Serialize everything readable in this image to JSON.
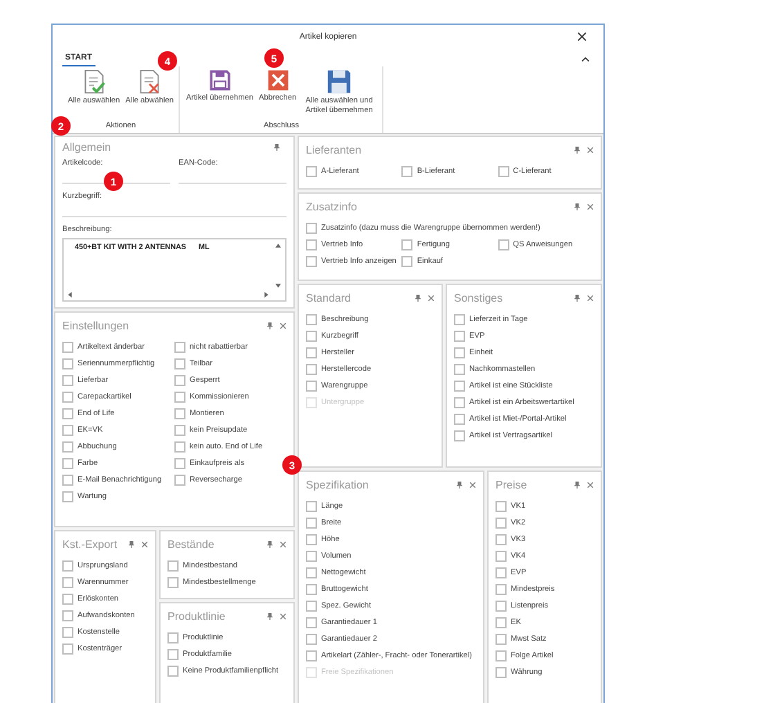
{
  "window": {
    "title": "Artikel kopieren"
  },
  "ribbon": {
    "tabs": [
      {
        "label": "START",
        "selected": true
      }
    ],
    "groups": [
      {
        "label": "Aktionen",
        "buttons": [
          {
            "label": "Alle auswählen",
            "kind": "select-all"
          },
          {
            "label": "Alle abwählen",
            "kind": "deselect-all"
          }
        ]
      },
      {
        "label": "Abschluss",
        "buttons": [
          {
            "label": "Artikel übernehmen",
            "kind": "save"
          },
          {
            "label": "Abbrechen",
            "kind": "cancel"
          },
          {
            "label": "Alle auswählen und Artikel übernehmen",
            "kind": "save-all"
          }
        ]
      }
    ]
  },
  "panels": [
    {
      "title": "Allgemein",
      "kind": "form",
      "closable": false,
      "rows": [
        [
          {
            "label": "Artikelcode:",
            "kind": "line"
          },
          {
            "label": "EAN-Code:",
            "kind": "line"
          }
        ],
        [
          {
            "label": "Kurzbegriff:",
            "kind": "line"
          }
        ],
        [
          {
            "label": "Beschreibung:",
            "kind": "textarea",
            "value": "450+BT KIT WITH 2 ANTENNAS      ML"
          }
        ]
      ]
    },
    {
      "title": "Lieferanten",
      "kind": "checklist",
      "closable": true,
      "rows": [
        [
          {
            "label": "A-Lieferant",
            "checked": false,
            "disabled": false
          },
          {
            "label": "B-Lieferant",
            "checked": false,
            "disabled": false
          },
          {
            "label": "C-Lieferant",
            "checked": false,
            "disabled": false
          }
        ]
      ]
    },
    {
      "title": "Zusatzinfo",
      "kind": "checklist",
      "closable": true,
      "rows": [
        [
          {
            "label": "Zusatzinfo (dazu muss die Warengruppe übernommen werden!)",
            "checked": false,
            "disabled": false
          }
        ],
        [
          {
            "label": "Vertrieb Info",
            "checked": false,
            "disabled": false
          },
          {
            "label": "Fertigung",
            "checked": false,
            "disabled": false
          },
          {
            "label": "QS Anweisungen",
            "checked": false,
            "disabled": false
          }
        ],
        [
          {
            "label": "Vertrieb Info anzeigen",
            "checked": false,
            "disabled": false
          },
          {
            "label": "Einkauf",
            "checked": false,
            "disabled": false
          }
        ]
      ]
    },
    {
      "title": "Einstellungen",
      "kind": "checklist",
      "closable": true,
      "rows": [
        [
          {
            "label": "Artikeltext änderbar",
            "checked": false,
            "disabled": false
          },
          {
            "label": "nicht rabattierbar",
            "checked": false,
            "disabled": false
          }
        ],
        [
          {
            "label": "Seriennummerpflichtig",
            "checked": false,
            "disabled": false
          },
          {
            "label": "Teilbar",
            "checked": false,
            "disabled": false
          }
        ],
        [
          {
            "label": "Lieferbar",
            "checked": false,
            "disabled": false
          },
          {
            "label": "Gesperrt",
            "checked": false,
            "disabled": false
          }
        ],
        [
          {
            "label": "Carepackartikel",
            "checked": false,
            "disabled": false
          },
          {
            "label": "Kommissionieren",
            "checked": false,
            "disabled": false
          }
        ],
        [
          {
            "label": "End of Life",
            "checked": false,
            "disabled": false
          },
          {
            "label": "Montieren",
            "checked": false,
            "disabled": false
          }
        ],
        [
          {
            "label": "EK=VK",
            "checked": false,
            "disabled": false
          },
          {
            "label": "kein Preisupdate",
            "checked": false,
            "disabled": false
          }
        ],
        [
          {
            "label": "Abbuchung",
            "checked": false,
            "disabled": false
          },
          {
            "label": "kein auto. End of Life",
            "checked": false,
            "disabled": false
          }
        ],
        [
          {
            "label": "Farbe",
            "checked": false,
            "disabled": false
          },
          {
            "label": "Einkaufpreis als",
            "checked": false,
            "disabled": false
          }
        ],
        [
          {
            "label": "E-Mail Benachrichtigung",
            "checked": false,
            "disabled": false
          },
          {
            "label": "Reversecharge",
            "checked": false,
            "disabled": false
          }
        ],
        [
          {
            "label": "Wartung",
            "checked": false,
            "disabled": false
          }
        ]
      ]
    },
    {
      "title": "Standard",
      "kind": "checklist",
      "closable": true,
      "rows": [
        [
          {
            "label": "Beschreibung",
            "checked": false,
            "disabled": false
          }
        ],
        [
          {
            "label": "Kurzbegriff",
            "checked": false,
            "disabled": false
          }
        ],
        [
          {
            "label": "Hersteller",
            "checked": false,
            "disabled": false
          }
        ],
        [
          {
            "label": "Herstellercode",
            "checked": false,
            "disabled": false
          }
        ],
        [
          {
            "label": "Warengruppe",
            "checked": false,
            "disabled": false
          }
        ],
        [
          {
            "label": "Untergruppe",
            "checked": false,
            "disabled": true
          }
        ]
      ]
    },
    {
      "title": "Sonstiges",
      "kind": "checklist",
      "closable": true,
      "rows": [
        [
          {
            "label": "Lieferzeit in Tage",
            "checked": false,
            "disabled": false
          }
        ],
        [
          {
            "label": "EVP",
            "checked": false,
            "disabled": false
          }
        ],
        [
          {
            "label": "Einheit",
            "checked": false,
            "disabled": false
          }
        ],
        [
          {
            "label": "Nachkommastellen",
            "checked": false,
            "disabled": false
          }
        ],
        [
          {
            "label": "Artikel ist eine Stückliste",
            "checked": false,
            "disabled": false
          }
        ],
        [
          {
            "label": "Artikel ist ein Arbeitswertartikel",
            "checked": false,
            "disabled": false
          }
        ],
        [
          {
            "label": "Artikel ist Miet-/Portal-Artikel",
            "checked": false,
            "disabled": false
          }
        ],
        [
          {
            "label": "Artikel ist Vertragsartikel",
            "checked": false,
            "disabled": false
          }
        ]
      ]
    },
    {
      "title": "Spezifikation",
      "kind": "checklist",
      "closable": true,
      "rows": [
        [
          {
            "label": "Länge",
            "checked": false,
            "disabled": false
          }
        ],
        [
          {
            "label": "Breite",
            "checked": false,
            "disabled": false
          }
        ],
        [
          {
            "label": "Höhe",
            "checked": false,
            "disabled": false
          }
        ],
        [
          {
            "label": "Volumen",
            "checked": false,
            "disabled": false
          }
        ],
        [
          {
            "label": "Nettogewicht",
            "checked": false,
            "disabled": false
          }
        ],
        [
          {
            "label": "Bruttogewicht",
            "checked": false,
            "disabled": false
          }
        ],
        [
          {
            "label": "Spez. Gewicht",
            "checked": false,
            "disabled": false
          }
        ],
        [
          {
            "label": "Garantiedauer 1",
            "checked": false,
            "disabled": false
          }
        ],
        [
          {
            "label": "Garantiedauer 2",
            "checked": false,
            "disabled": false
          }
        ],
        [
          {
            "label": "Artikelart (Zähler-, Fracht- oder Tonerartikel)",
            "checked": false,
            "disabled": false
          }
        ],
        [
          {
            "label": "Freie Spezifikationen",
            "checked": false,
            "disabled": true
          }
        ]
      ]
    },
    {
      "title": "Preise",
      "kind": "checklist",
      "closable": true,
      "rows": [
        [
          {
            "label": "VK1",
            "checked": false,
            "disabled": false
          }
        ],
        [
          {
            "label": "VK2",
            "checked": false,
            "disabled": false
          }
        ],
        [
          {
            "label": "VK3",
            "checked": false,
            "disabled": false
          }
        ],
        [
          {
            "label": "VK4",
            "checked": false,
            "disabled": false
          }
        ],
        [
          {
            "label": "EVP",
            "checked": false,
            "disabled": false
          }
        ],
        [
          {
            "label": "Mindestpreis",
            "checked": false,
            "disabled": false
          }
        ],
        [
          {
            "label": "Listenpreis",
            "checked": false,
            "disabled": false
          }
        ],
        [
          {
            "label": "EK",
            "checked": false,
            "disabled": false
          }
        ],
        [
          {
            "label": "Mwst Satz",
            "checked": false,
            "disabled": false
          }
        ],
        [
          {
            "label": "Folge Artikel",
            "checked": false,
            "disabled": false
          }
        ],
        [
          {
            "label": "Währung",
            "checked": false,
            "disabled": false
          }
        ]
      ]
    },
    {
      "title": "Kst.-Export",
      "kind": "checklist",
      "closable": true,
      "rows": [
        [
          {
            "label": "Ursprungsland",
            "checked": false,
            "disabled": false
          }
        ],
        [
          {
            "label": "Warennummer",
            "checked": false,
            "disabled": false
          }
        ],
        [
          {
            "label": "Erlöskonten",
            "checked": false,
            "disabled": false
          }
        ],
        [
          {
            "label": "Aufwandskonten",
            "checked": false,
            "disabled": false
          }
        ],
        [
          {
            "label": "Kostenstelle",
            "checked": false,
            "disabled": false
          }
        ],
        [
          {
            "label": "Kostenträger",
            "checked": false,
            "disabled": false
          }
        ]
      ]
    },
    {
      "title": "Bestände",
      "kind": "checklist",
      "closable": true,
      "rows": [
        [
          {
            "label": "Mindestbestand",
            "checked": false,
            "disabled": false
          }
        ],
        [
          {
            "label": "Mindestbestellmenge",
            "checked": false,
            "disabled": false
          }
        ]
      ]
    },
    {
      "title": "Produktlinie",
      "kind": "checklist",
      "closable": true,
      "rows": [
        [
          {
            "label": "Produktlinie",
            "checked": false,
            "disabled": false
          }
        ],
        [
          {
            "label": "Produktfamilie",
            "checked": false,
            "disabled": false
          }
        ],
        [
          {
            "label": "Keine Produktfamilienpflicht",
            "checked": false,
            "disabled": false
          }
        ]
      ]
    }
  ],
  "callouts": [
    {
      "label": "1"
    },
    {
      "label": "2"
    },
    {
      "label": "3"
    },
    {
      "label": "4"
    },
    {
      "label": "5"
    }
  ]
}
